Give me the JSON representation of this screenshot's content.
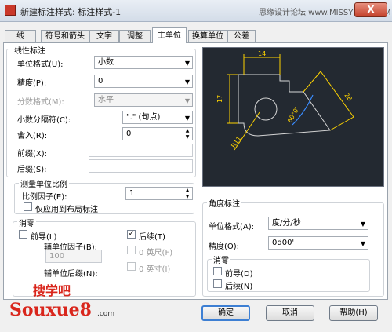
{
  "window": {
    "title": "新建标注样式: 标注样式-1",
    "watermark": "思缘设计论坛 www.MISSYUAN.COM",
    "close_label": "X"
  },
  "tabs": [
    {
      "label": "线"
    },
    {
      "label": "符号和箭头"
    },
    {
      "label": "文字"
    },
    {
      "label": "调整"
    },
    {
      "label": "主单位",
      "active": true
    },
    {
      "label": "换算单位"
    },
    {
      "label": "公差"
    }
  ],
  "linear": {
    "title": "线性标注",
    "unit_format_label": "单位格式(U):",
    "unit_format_value": "小数",
    "precision_label": "精度(P):",
    "precision_value": "0",
    "fraction_label": "分数格式(M):",
    "fraction_value": "水平",
    "decimal_sep_label": "小数分隔符(C):",
    "decimal_sep_value": "\".\" (句点)",
    "roundoff_label": "舍入(R):",
    "roundoff_value": "0",
    "prefix_label": "前缀(X):",
    "prefix_value": "",
    "suffix_label": "后缀(S):",
    "suffix_value": ""
  },
  "scale": {
    "title": "测量单位比例",
    "factor_label": "比例因子(E):",
    "factor_value": "1",
    "layout_only_label": "仅应用到布局标注",
    "layout_only_checked": false
  },
  "zero_linear": {
    "title": "消零",
    "leading_label": "前导(L)",
    "leading_checked": false,
    "trailing_label": "后续(T)",
    "trailing_checked": true,
    "sub_factor_label": "辅单位因子(B):",
    "sub_factor_value": "100",
    "feet_label": "0 英尺(F)",
    "inches_label": "0 英寸(I)",
    "sub_suffix_label": "辅单位后缀(N):"
  },
  "angular": {
    "title": "角度标注",
    "unit_format_label": "单位格式(A):",
    "unit_format_value": "度/分/秒",
    "precision_label": "精度(O):",
    "precision_value": "0d00'",
    "zero_title": "消零",
    "leading_label": "前导(D)",
    "leading_checked": false,
    "trailing_label": "后续(N)",
    "trailing_checked": false
  },
  "preview": {
    "dim_top": "14",
    "dim_left": "17",
    "dim_right": "28",
    "dim_angle": "60°0'",
    "dim_radius": "R11",
    "line_color": "#d6d6d6",
    "dim_color": "#ffd400",
    "arc_color": "#3a8cff"
  },
  "buttons": {
    "ok": "确定",
    "cancel": "取消",
    "help": "帮助(H)"
  },
  "logo": {
    "cn": "搜学吧",
    "en": "Souxue8",
    "com": ".com"
  }
}
